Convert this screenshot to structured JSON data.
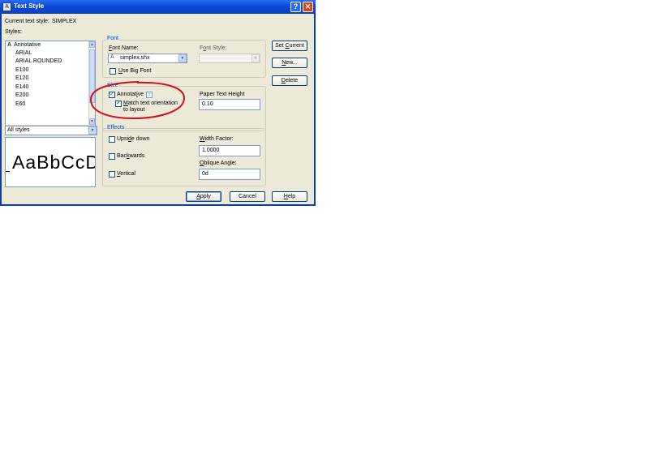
{
  "window": {
    "title": "Text Style",
    "help": "?",
    "close": "✕",
    "icon_glyph": "A"
  },
  "current_style": {
    "label": "Current text style:",
    "value": "SIMPLEX"
  },
  "styles": {
    "label": "Styles:",
    "items": [
      {
        "label": "Annotative",
        "icon": "annotative-icon",
        "glyph": "A"
      },
      {
        "label": "ARIAL"
      },
      {
        "label": "ARIAL ROUNDED"
      },
      {
        "label": "E100"
      },
      {
        "label": "E120"
      },
      {
        "label": "E140"
      },
      {
        "label": "E200"
      },
      {
        "label": "E60"
      }
    ]
  },
  "filter": {
    "value": "All styles"
  },
  "preview": {
    "sample": "AaBbCcD"
  },
  "font": {
    "group_label": "Font",
    "name_label": "Font Name:",
    "name_value": "simplex.shx",
    "name_icon_glyph": "Ā",
    "style_label": "Font Style:",
    "style_value": "",
    "big_font_label": "Use Big Font",
    "big_font_checked": false
  },
  "size": {
    "group_label": "Size",
    "annotative_label": "Annotative",
    "annotative_checked": true,
    "info_glyph": "i",
    "match_label_line1": "Match text orientation",
    "match_label_line2": "to layout",
    "match_checked": true,
    "height_label": "Paper Text Height",
    "height_value": "0.10"
  },
  "effects": {
    "group_label": "Effects",
    "upside_down_label": "Upside down",
    "backwards_label": "Backwards",
    "vertical_label": "Vertical",
    "width_factor_label": "Width Factor:",
    "width_factor_value": "1.0000",
    "oblique_label": "Oblique Angle:",
    "oblique_value": "0d"
  },
  "buttons": {
    "set_current": "Set Current",
    "new": "New...",
    "delete": "Delete",
    "apply": "Apply",
    "cancel": "Cancel",
    "help": "Help"
  },
  "colors": {
    "title_bar": "#0a4ad7",
    "dialog_bg": "#ece9d8",
    "group_label": "#0046d5",
    "annotation_circle": "#d0101a"
  }
}
